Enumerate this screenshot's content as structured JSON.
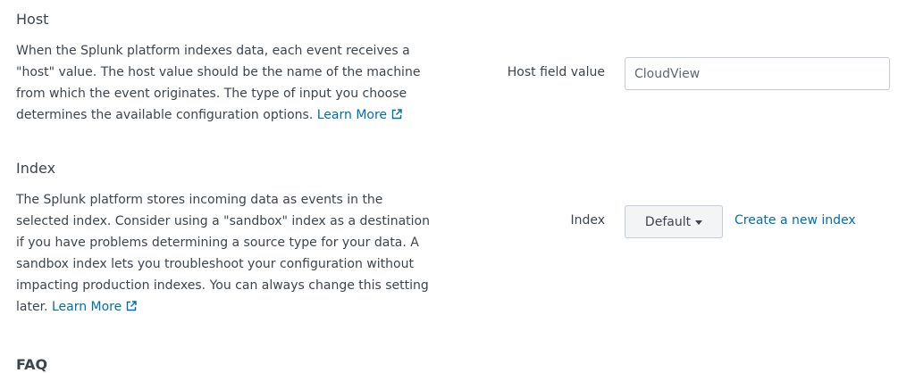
{
  "host": {
    "title": "Host",
    "description": "When the Splunk platform indexes data, each event receives a \"host\" value. The host value should be the name of the machine from which the event originates. The type of input you choose determines the available configuration options.",
    "learn_more": "Learn More",
    "field_label": "Host field value",
    "field_value": "CloudView"
  },
  "index": {
    "title": "Index",
    "description": "The Splunk platform stores incoming data as events in the selected index. Consider using a \"sandbox\" index as a destination if you have problems determining a source type for your data. A sandbox index lets you troubleshoot your configuration without impacting production indexes. You can always change this setting later.",
    "learn_more": "Learn More",
    "field_label": "Index",
    "selected_value": "Default",
    "create_link": "Create a new index"
  },
  "next_section": {
    "title": "FAQ"
  },
  "colors": {
    "text": "#3c444d",
    "link": "#006eaa",
    "border": "#c3cbd4",
    "dropdown_bg": "#f2f4f5"
  },
  "icons": {
    "external_link": "external-link-icon",
    "dropdown_caret": "caret-down-icon"
  }
}
